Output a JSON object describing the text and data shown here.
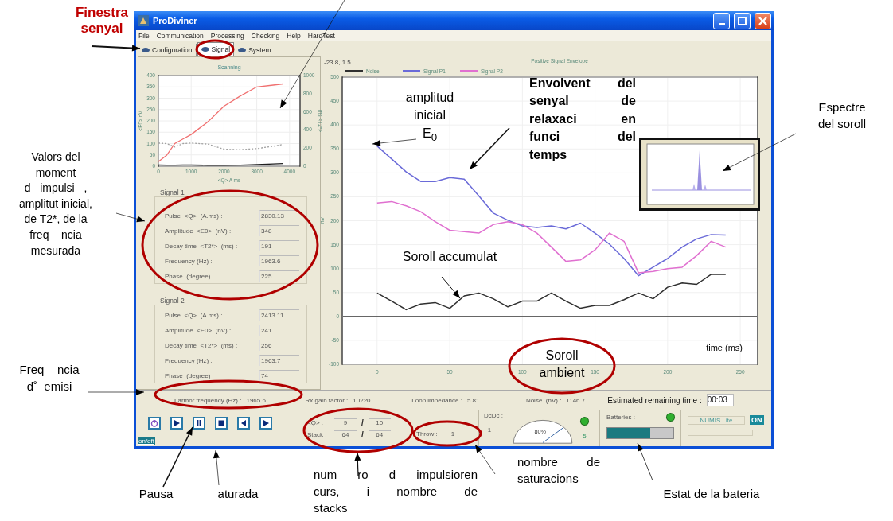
{
  "window": {
    "title": "ProDiviner"
  },
  "menu": [
    "File",
    "Communication",
    "Processing",
    "Checking",
    "Help",
    "HardTest"
  ],
  "tabs": [
    {
      "label": "Configuration",
      "selected": false
    },
    {
      "label": "Signal",
      "selected": true
    },
    {
      "label": "System",
      "selected": false
    }
  ],
  "scanning": {
    "chart_data": {
      "type": "line",
      "title": "Scanning",
      "xlabel": "<Q> A ms",
      "ylabel": "<E0> nV",
      "y2label": "ms <T2*>",
      "grid": true,
      "x": [
        0,
        250,
        500,
        750,
        1000,
        1500,
        2000,
        2500,
        3000,
        3500,
        3800
      ],
      "xlim": [
        0,
        4320
      ],
      "ylim": [
        0,
        400
      ],
      "y2lim": [
        0,
        1000
      ],
      "xticks": [
        0,
        1000,
        2000,
        3000,
        4000
      ],
      "yticks": [
        0,
        50,
        100,
        150,
        200,
        250,
        300,
        350,
        400
      ],
      "y2ticks": [
        0,
        200,
        400,
        600,
        800,
        1000
      ],
      "series": [
        {
          "color": "#f07070",
          "line_style": "solid",
          "values": [
            20,
            48,
            100,
            120,
            140,
            195,
            265,
            310,
            350,
            358,
            363
          ]
        },
        {
          "color": "#a0a0a0",
          "line_style": "dashed",
          "values": [
            102,
            100,
            85,
            100,
            102,
            98,
            75,
            73,
            78,
            88,
            96
          ]
        },
        {
          "color": "#202020",
          "line_style": "solid",
          "values": [
            6,
            5,
            5,
            6,
            6,
            4,
            4,
            5,
            7,
            10,
            12
          ]
        }
      ]
    }
  },
  "signal_groups": [
    {
      "title": "Signal 1",
      "fields": [
        {
          "label": "Pulse  <Q>  (A.ms) :",
          "value": "2830.13"
        },
        {
          "label": "Amplitude  <E0>  (nV) :",
          "value": "348"
        },
        {
          "label": "Decay time  <T2*>  (ms) :",
          "value": "191"
        },
        {
          "label": "Frequency (Hz) :",
          "value": "1963.6"
        },
        {
          "label": "Phase  (degree) :",
          "value": "225"
        }
      ]
    },
    {
      "title": "Signal 2",
      "fields": [
        {
          "label": "Pulse  <Q>  (A.ms) :",
          "value": "2413.11"
        },
        {
          "label": "Amplitude  <E0>  (nV) :",
          "value": "241"
        },
        {
          "label": "Decay time  <T2*>  (ms) :",
          "value": "256"
        },
        {
          "label": "Frequency (Hz) :",
          "value": "1963.7"
        },
        {
          "label": "Phase  (degree) :",
          "value": "74"
        }
      ]
    }
  ],
  "envelope": {
    "cursor": "-23.8, 1.5",
    "chart_data": {
      "type": "line",
      "title": "Positive Signal Envelope",
      "xlabel": "time (ms)",
      "ylabel": "nV",
      "grid": true,
      "legend": "top",
      "x": [
        0,
        10,
        20,
        30,
        40,
        50,
        60,
        70,
        80,
        90,
        100,
        110,
        120,
        130,
        140,
        150,
        160,
        170,
        180,
        190,
        200,
        210,
        220,
        230,
        240
      ],
      "xlim": [
        -24,
        262
      ],
      "ylim": [
        -100,
        500
      ],
      "xticks": [
        0,
        50,
        100,
        150,
        200,
        250
      ],
      "yticks": [
        -100,
        -50,
        0,
        50,
        100,
        150,
        200,
        250,
        300,
        350,
        400,
        450,
        500
      ],
      "series": [
        {
          "name": "Noise",
          "color": "#303030",
          "values": [
            49,
            32,
            14,
            26,
            29,
            17,
            43,
            49,
            37,
            20,
            32,
            32,
            49,
            32,
            17,
            23,
            23,
            35,
            49,
            37,
            61,
            70,
            67,
            88,
            88
          ]
        },
        {
          "name": "Signal P1",
          "color": "#6a6ad8",
          "values": [
            356,
            329,
            302,
            282,
            282,
            290,
            287,
            252,
            216,
            201,
            189,
            186,
            189,
            183,
            195,
            174,
            151,
            121,
            85,
            103,
            121,
            145,
            162,
            171,
            170
          ]
        },
        {
          "name": "Signal P2",
          "color": "#e070d0",
          "values": [
            237,
            240,
            231,
            219,
            198,
            180,
            177,
            174,
            192,
            198,
            192,
            174,
            145,
            115,
            118,
            139,
            174,
            157,
            91,
            94,
            100,
            103,
            127,
            157,
            145
          ]
        }
      ]
    }
  },
  "status_row": [
    {
      "kind": "field",
      "label": "Larmor frequency (Hz) :",
      "value": "1965.6"
    },
    {
      "kind": "field",
      "label": "Rx gain factor :",
      "value": "10220"
    },
    {
      "kind": "field",
      "label": "Loop impedance :",
      "value": "5.81"
    },
    {
      "kind": "field",
      "label": "Noise  (nV) :",
      "value": "1146.7"
    },
    {
      "kind": "emphasis",
      "label": "Estimated remaining time :",
      "value": "00:03"
    }
  ],
  "controls": {
    "buttons": [
      {
        "kind": "power"
      },
      {
        "kind": "play"
      },
      {
        "kind": "pause"
      },
      {
        "kind": "stop"
      },
      {
        "kind": "prev"
      },
      {
        "kind": "next"
      }
    ],
    "power_label": "on/off"
  },
  "counters": {
    "rows": [
      {
        "label": "<Q> :",
        "current": "9",
        "separator": "/",
        "total": "10"
      },
      {
        "label": "Stack :",
        "current": "64",
        "separator": "/",
        "total": "64"
      }
    ],
    "throw_label": "Throw :",
    "throw_value": "1"
  },
  "dcdc": {
    "label": "DcDc :",
    "value": "1",
    "gauge": {
      "reading": "80%"
    },
    "led_on": true,
    "count": "5"
  },
  "batteries": {
    "label": "Batteries :",
    "led_on": true,
    "level": 0.65
  },
  "device": {
    "name": "NUMIS Lite",
    "on": true,
    "on_label": "ON"
  },
  "annotations": [
    {
      "kind": "heading",
      "lines": [
        "Finestra",
        "senyal"
      ]
    },
    {
      "kind": "note",
      "lines": [
        "amplitud",
        "inicial",
        "E$_{0}$"
      ]
    },
    {
      "kind": "bold_justified",
      "lines": [
        "Envolvent del",
        "senyal de",
        "relaxaci en",
        "funci del",
        "temps"
      ]
    },
    {
      "kind": "note",
      "lines": [
        "Espectre",
        "del soroll"
      ]
    },
    {
      "kind": "note",
      "lines": [
        "Valors del",
        "moment",
        "d   impulsi   ,",
        "amplitut inicial,",
        "de T2*, de la",
        "freq    ncia",
        "mesurada"
      ]
    },
    {
      "kind": "note",
      "lines": [
        "Soroll accumulat"
      ]
    },
    {
      "kind": "note",
      "lines": [
        "Soroll",
        "ambient"
      ]
    },
    {
      "kind": "note",
      "lines": [
        "Freq    ncia",
        "d˚  emisi"
      ]
    },
    {
      "kind": "note",
      "lines": [
        "Pausa"
      ]
    },
    {
      "kind": "note",
      "lines": [
        "aturada"
      ]
    },
    {
      "kind": "justified",
      "lines": [
        "num ro d impulsioren",
        "curs, i nombre de",
        "stacks"
      ]
    },
    {
      "kind": "justified",
      "lines": [
        "nombre de",
        "saturacions"
      ]
    },
    {
      "kind": "note",
      "lines": [
        "Estat de la bateria"
      ]
    }
  ]
}
